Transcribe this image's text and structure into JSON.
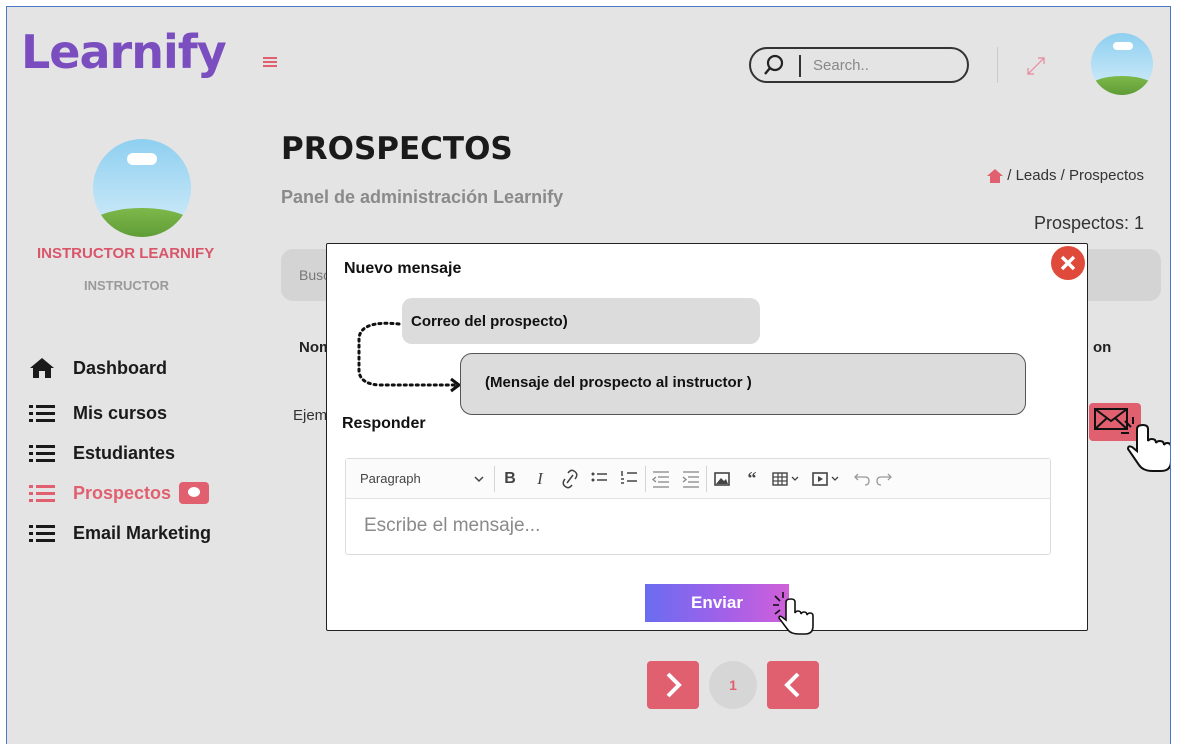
{
  "brand": {
    "logo_text": "Learnify",
    "accent_color": "#e06070",
    "logo_color": "#7b4ec0"
  },
  "header": {
    "search_placeholder": "Search.."
  },
  "user": {
    "name": "INSTRUCTOR LEARNIFY",
    "role": "INSTRUCTOR"
  },
  "sidebar": {
    "items": [
      {
        "label": "Dashboard",
        "icon": "home-icon"
      },
      {
        "label": "Mis cursos",
        "icon": "list-icon"
      },
      {
        "label": "Estudiantes",
        "icon": "list-icon"
      },
      {
        "label": "Prospectos",
        "icon": "list-icon",
        "active": true,
        "badge_icon": "chat-badge-icon"
      },
      {
        "label": "Email Marketing",
        "icon": "list-icon"
      }
    ]
  },
  "main": {
    "title": "PROSPECTOS",
    "subtitle": "Panel de administración Learnify",
    "breadcrumb": "/ Leads / Prospectos",
    "count_label": "Prospectos: 1",
    "filter_text": "Busc",
    "table": {
      "header_left": "Nom",
      "header_right": "on",
      "row_first_cell": "Ejem"
    },
    "pagination": {
      "current_page": "1"
    }
  },
  "modal": {
    "title": "Nuevo mensaje",
    "email_label": "Correo del prospecto)",
    "message_label": "(Mensaje del prospecto al instructor )",
    "reply_label": "Responder",
    "editor": {
      "paragraph_select": "Paragraph",
      "placeholder": "Escribe el mensaje..."
    },
    "send_label": "Enviar"
  }
}
